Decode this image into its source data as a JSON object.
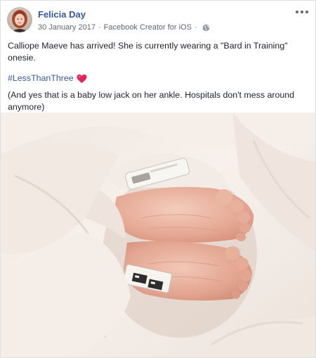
{
  "post": {
    "author": {
      "name": "Felicia Day",
      "avatar_icon": "profile-photo"
    },
    "meta": {
      "date": "30 January 2017",
      "separator": "·",
      "app": "Facebook Creator for iOS",
      "privacy_icon": "globe-icon"
    },
    "more_icon": "more-options-icon",
    "text": {
      "line1": "Calliope Maeve has arrived! She is currently wearing a \"Bard in Training\" onesie.",
      "hashtag": "#LessThanThree",
      "heart_icon": "heart-emoji",
      "line3": "(And yes that is a baby low jack on her ankle. Hospitals don't mess around anymore)"
    },
    "photo": {
      "subject": "baby-feet-photo"
    }
  },
  "colors": {
    "link": "#365899",
    "meta_text": "#616770",
    "body_text": "#1d2129",
    "heart": "#e0245e"
  }
}
